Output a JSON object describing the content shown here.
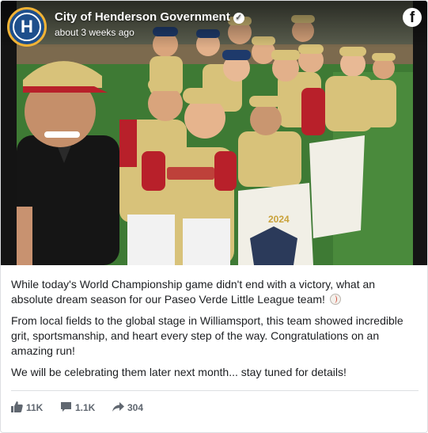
{
  "post": {
    "page_name": "City of Henderson Government",
    "time": "about 3 weeks ago",
    "avatar_letter": "H",
    "fb_letter": "f",
    "paragraphs": [
      "While today's World Championship game didn't end with a victory, what an absolute dream season for our Paseo Verde Little League team!",
      "From local fields to the global stage in Williamsport, this team showed incredible grit, sportsmanship, and heart every step of the way. Congratulations on an amazing run!",
      "We will be celebrating them later next month... stay tuned for details!"
    ]
  },
  "stats": {
    "likes": "11K",
    "comments": "1.1K",
    "shares": "304"
  },
  "colors": {
    "avatar_bg": "#1e4f8c",
    "avatar_ring": "#f2b335",
    "jersey_gold": "#d8c27a",
    "jersey_red": "#b8202a",
    "field_green": "#3e7a34"
  },
  "icons": {
    "verified": "verified-badge-icon",
    "facebook": "facebook-logo-icon",
    "like": "thumbs-up-icon",
    "comment": "comment-icon",
    "share": "share-arrow-icon",
    "baseball": "baseball-emoji-icon"
  }
}
